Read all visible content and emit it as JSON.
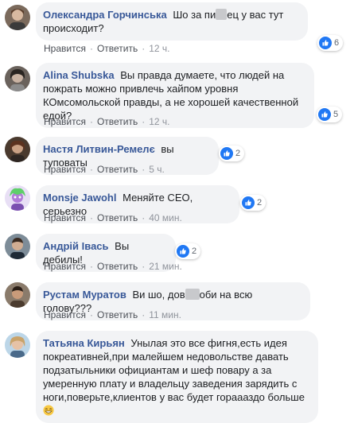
{
  "actions": {
    "like": "Нравится",
    "reply": "Ответить",
    "dot": "·"
  },
  "comments": [
    {
      "author": "Олександра Горчинська",
      "text_a": "Шо за пи",
      "text_b": "ец у вас тут происходит?",
      "time": "12 ч.",
      "reactions": "6"
    },
    {
      "author": "Alina Shubska",
      "text": "Вы правда думаете, что людей на пожрать можно привлечь хайпом уровня КОмсомольской правды, а не хорошей качественной едой?",
      "time": "12 ч.",
      "reactions": "5"
    },
    {
      "author": "Настя Литвин-Ремелє",
      "text": "вы туповаты",
      "time": "5 ч.",
      "reactions": "2"
    },
    {
      "author": "Monsje Jawohl",
      "text": "Меняйте СЕО, серьезно",
      "time": "40 мин.",
      "reactions": "2"
    },
    {
      "author": "Андрій Івась",
      "text": "Вы дебилы!",
      "time": "21 мин.",
      "reactions": "2"
    },
    {
      "author": "Рустам Муратов",
      "text_a": "Ви шо, дов",
      "text_b": "оби на всю голову???",
      "time": "11 мин."
    },
    {
      "author": "Татьяна Кирьян",
      "text": "Унылая это все фигня,есть идея покреативней,при малейшем недовольстве давать подзатыльники официантам и шеф повару а за умеренную плату и владельцу заведения зарядить с ноги,поверьте,клиентов у вас будет гораааздо больше",
      "emoji": "grin-emoji"
    }
  ]
}
